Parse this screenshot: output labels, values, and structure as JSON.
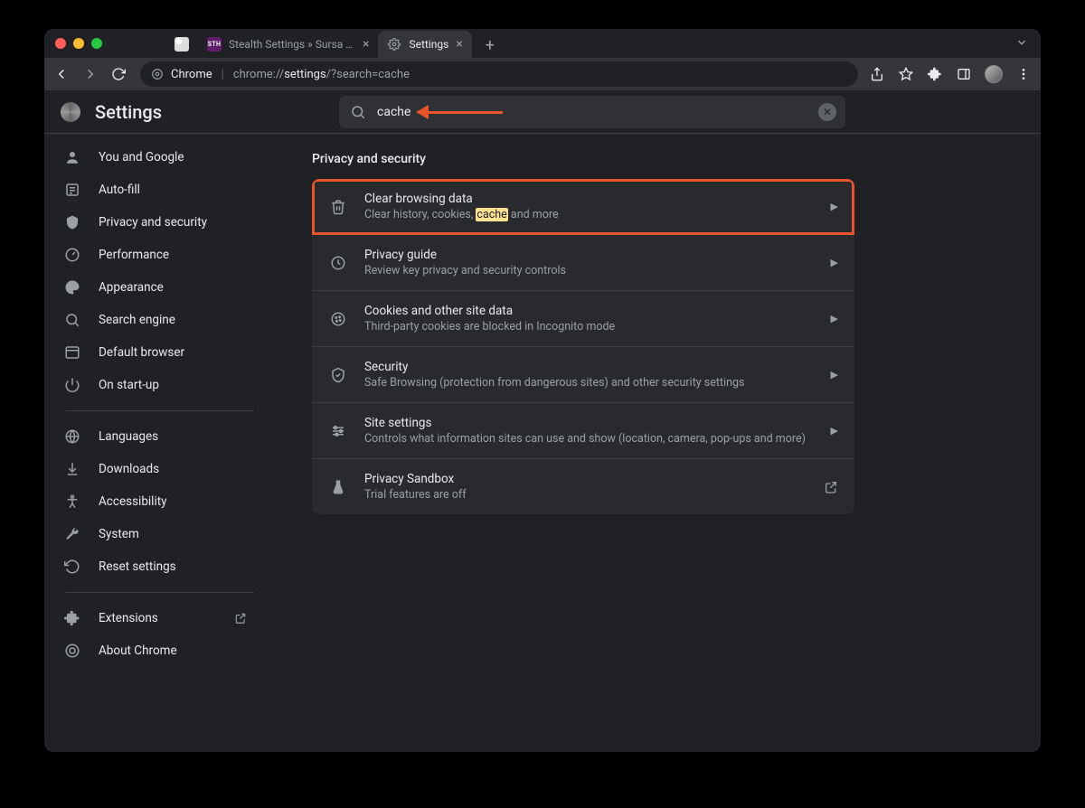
{
  "tabs": [
    {
      "label": "",
      "favicon": "google"
    },
    {
      "label": "Stealth Settings » Sursa de tut",
      "favicon": "sth"
    },
    {
      "label": "Settings",
      "favicon": "gear",
      "active": true
    }
  ],
  "url": {
    "host_label": "Chrome",
    "prefix": "chrome://",
    "bold": "settings",
    "rest": "/?search=cache"
  },
  "settings_title": "Settings",
  "search": {
    "value": "cache"
  },
  "section_title": "Privacy and security",
  "sidebar": {
    "items": [
      {
        "label": "You and Google",
        "icon": "person"
      },
      {
        "label": "Auto-fill",
        "icon": "autofill"
      },
      {
        "label": "Privacy and security",
        "icon": "shield"
      },
      {
        "label": "Performance",
        "icon": "speed"
      },
      {
        "label": "Appearance",
        "icon": "palette"
      },
      {
        "label": "Search engine",
        "icon": "search"
      },
      {
        "label": "Default browser",
        "icon": "browser"
      },
      {
        "label": "On start-up",
        "icon": "power"
      }
    ],
    "items2": [
      {
        "label": "Languages",
        "icon": "globe"
      },
      {
        "label": "Downloads",
        "icon": "download"
      },
      {
        "label": "Accessibility",
        "icon": "accessibility"
      },
      {
        "label": "System",
        "icon": "wrench"
      },
      {
        "label": "Reset settings",
        "icon": "reset"
      }
    ],
    "items3": [
      {
        "label": "Extensions",
        "icon": "extension",
        "external": true
      },
      {
        "label": "About Chrome",
        "icon": "chrome"
      }
    ]
  },
  "rows": [
    {
      "title": "Clear browsing data",
      "desc_pre": "Clear history, cookies, ",
      "desc_hl": "cache",
      "desc_post": " and more",
      "icon": "trash",
      "arrow": true,
      "highlighted": true
    },
    {
      "title": "Privacy guide",
      "desc": "Review key privacy and security controls",
      "icon": "guide",
      "arrow": true
    },
    {
      "title": "Cookies and other site data",
      "desc": "Third-party cookies are blocked in Incognito mode",
      "icon": "cookie",
      "arrow": true
    },
    {
      "title": "Security",
      "desc": "Safe Browsing (protection from dangerous sites) and other security settings",
      "icon": "security",
      "arrow": true
    },
    {
      "title": "Site settings",
      "desc": "Controls what information sites can use and show (location, camera, pop-ups and more)",
      "icon": "tune",
      "arrow": true
    },
    {
      "title": "Privacy Sandbox",
      "desc": "Trial features are off",
      "icon": "sandbox",
      "external": true
    }
  ]
}
